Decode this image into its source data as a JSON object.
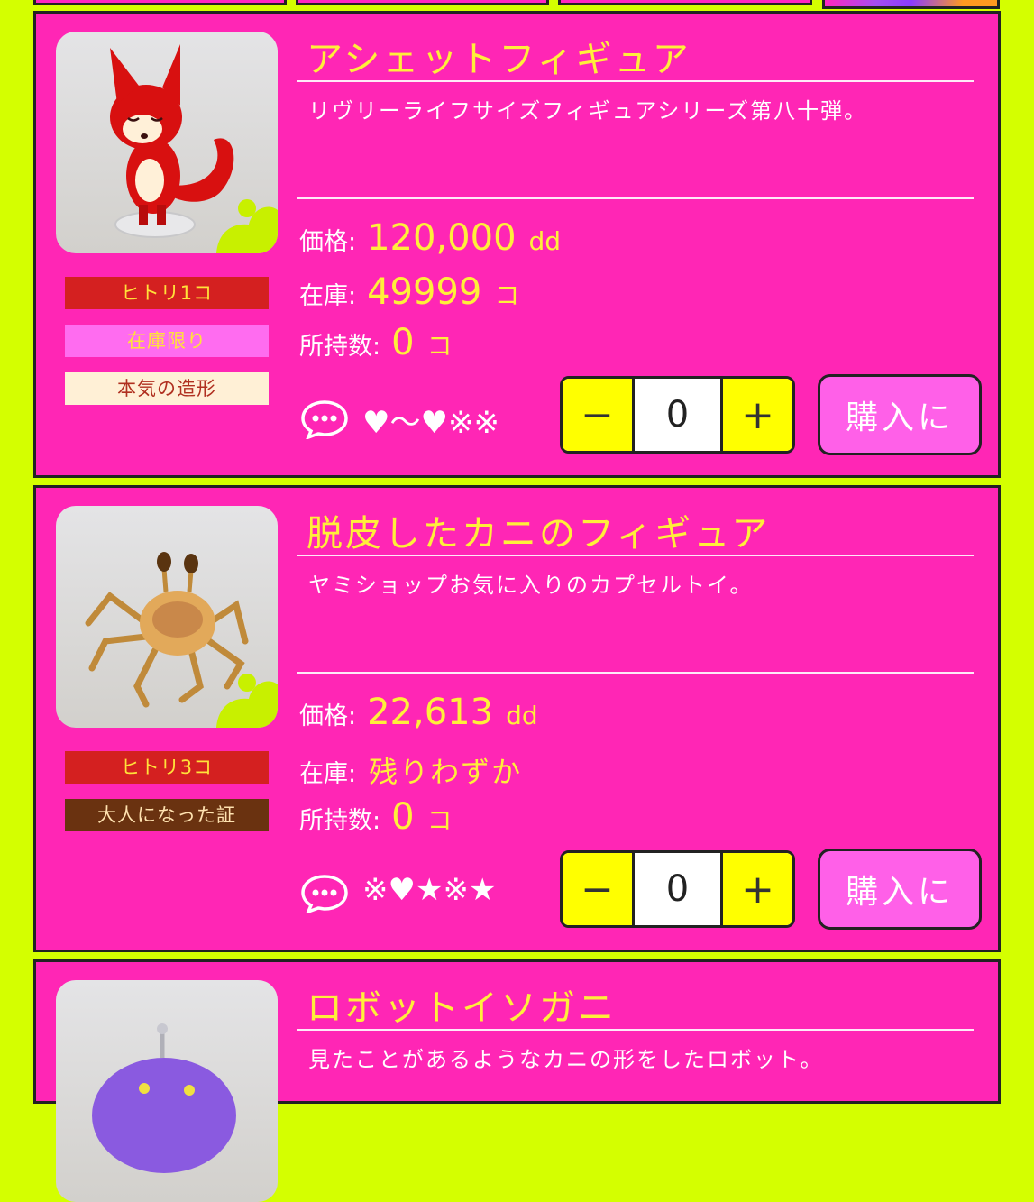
{
  "products": [
    {
      "title": "アシェットフィギュア",
      "description": "リヴリーライフサイズフィギュアシリーズ第八十弾。",
      "tags": [
        {
          "text": "ヒトリ1コ",
          "bg": "#d42020",
          "color": "#ffe23a"
        },
        {
          "text": "在庫限り",
          "bg": "#ff6cf0",
          "color": "#ffe23a"
        },
        {
          "text": "本気の造形",
          "bg": "#fff0d6",
          "color": "#b03020"
        }
      ],
      "price_label": "価格:",
      "price_value": "120,000",
      "price_unit": "dd",
      "stock_label": "在庫:",
      "stock_value": "49999",
      "stock_unit": "コ",
      "owned_label": "所持数:",
      "owned_value": "0",
      "owned_unit": "コ",
      "comment_symbols": "♥〜♥※※",
      "quantity": "0",
      "minus": "−",
      "plus": "+",
      "buy_label": "購入に"
    },
    {
      "title": "脱皮したカニのフィギュア",
      "description": "ヤミショップお気に入りのカプセルトイ。",
      "tags": [
        {
          "text": "ヒトリ3コ",
          "bg": "#d42020",
          "color": "#ffe23a"
        },
        {
          "text": "大人になった証",
          "bg": "#6a3210",
          "color": "#ffe2b0"
        }
      ],
      "price_label": "価格:",
      "price_value": "22,613",
      "price_unit": "dd",
      "stock_label": "在庫:",
      "stock_value": "残りわずか",
      "owned_label": "所持数:",
      "owned_value": "0",
      "owned_unit": "コ",
      "comment_symbols": "※♥★※★",
      "quantity": "0",
      "minus": "−",
      "plus": "+",
      "buy_label": "購入に"
    },
    {
      "title": "ロボットイソガニ",
      "description": "見たことがあるようなカニの形をしたロボット。"
    }
  ],
  "colors": {
    "page_bg": "#d4ff00",
    "card_bg": "#ff26b5",
    "title": "#ffef3a",
    "stepper_btn": "#ffff00",
    "buy_btn": "#ff60e8"
  }
}
